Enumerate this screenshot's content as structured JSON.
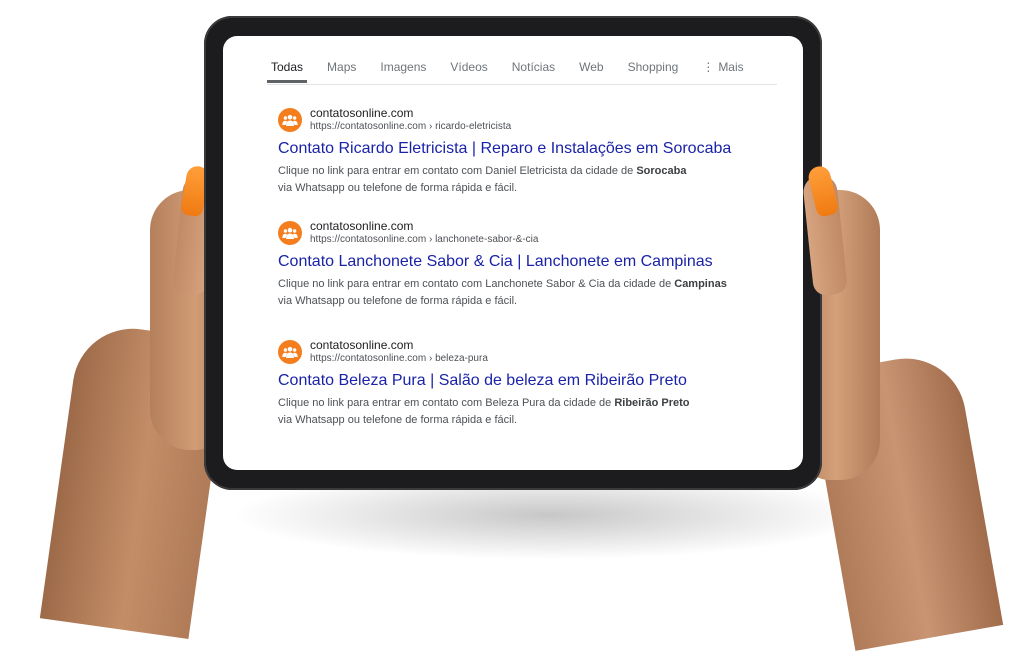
{
  "tabs": [
    {
      "label": "Todas",
      "active": true
    },
    {
      "label": "Maps"
    },
    {
      "label": "Imagens"
    },
    {
      "label": "Vídeos"
    },
    {
      "label": "Notícias"
    },
    {
      "label": "Web"
    },
    {
      "label": "Shopping"
    },
    {
      "label": "Mais",
      "icon": "more-vert-icon"
    }
  ],
  "results": [
    {
      "site": "contatosonline.com",
      "url": "https://contatosonline.com › ricardo-eletricista",
      "title": "Contato Ricardo Eletricista | Reparo e Instalações em Sorocaba",
      "desc_prefix": "Clique no link para entrar em contato com Daniel Eletricista da cidade de ",
      "desc_city": "Sorocaba",
      "desc_suffix": "via Whatsapp ou telefone de forma rápida e fácil.",
      "icon": "people-group-icon"
    },
    {
      "site": "contatosonline.com",
      "url": "https://contatosonline.com › lanchonete-sabor-&-cia",
      "title": "Contato Lanchonete Sabor & Cia | Lanchonete em Campinas",
      "desc_prefix": "Clique no link para entrar em contato com Lanchonete Sabor & Cia da cidade de ",
      "desc_city": "Campinas",
      "desc_suffix": "via Whatsapp ou telefone de forma rápida e fácil.",
      "icon": "people-group-icon"
    },
    {
      "site": "contatosonline.com",
      "url": "https://contatosonline.com › beleza-pura",
      "title": "Contato Beleza Pura | Salão de beleza em Ribeirão Preto",
      "desc_prefix": "Clique no link para entrar em contato com Beleza Pura da cidade de ",
      "desc_city": "Ribeirão Preto",
      "desc_suffix": "via Whatsapp ou telefone de forma rápida e fácil.",
      "icon": "people-group-icon"
    }
  ],
  "colors": {
    "favicon": "#f47d1e",
    "title_link": "#1a23a8",
    "nail": "#f58a1f"
  }
}
